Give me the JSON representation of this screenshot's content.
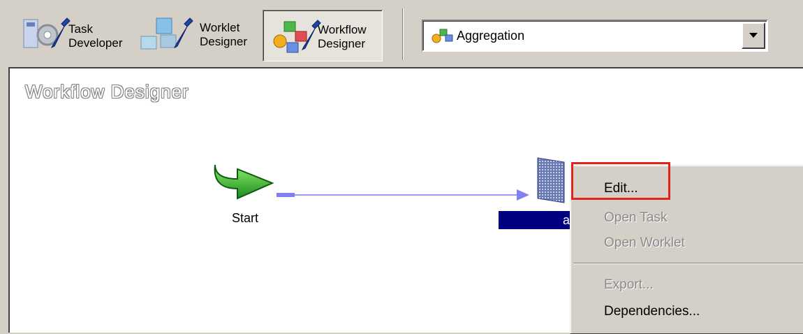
{
  "toolbar": {
    "tools": [
      {
        "line1": "Task",
        "line2": "Developer"
      },
      {
        "line1": "Worklet",
        "line2": "Designer"
      },
      {
        "line1": "Workflow",
        "line2": "Designer"
      }
    ],
    "active_tool": "Workflow Designer",
    "workflow_select": {
      "value": "Aggregation"
    }
  },
  "canvas": {
    "title": "Workflow Designer",
    "start_label": "Start",
    "task_label": "a"
  },
  "context_menu": {
    "items": [
      {
        "label": "Edit...",
        "enabled": true,
        "highlighted": true
      },
      {
        "label": "Open Task",
        "enabled": false
      },
      {
        "label": "Open Worklet",
        "enabled": false
      },
      {
        "label": "Export...",
        "enabled": false
      },
      {
        "label": "Dependencies...",
        "enabled": true
      }
    ]
  },
  "colors": {
    "highlight_border": "#e2231a",
    "selection": "#000080",
    "link": "#8080f0",
    "background": "#d4d0c8"
  }
}
